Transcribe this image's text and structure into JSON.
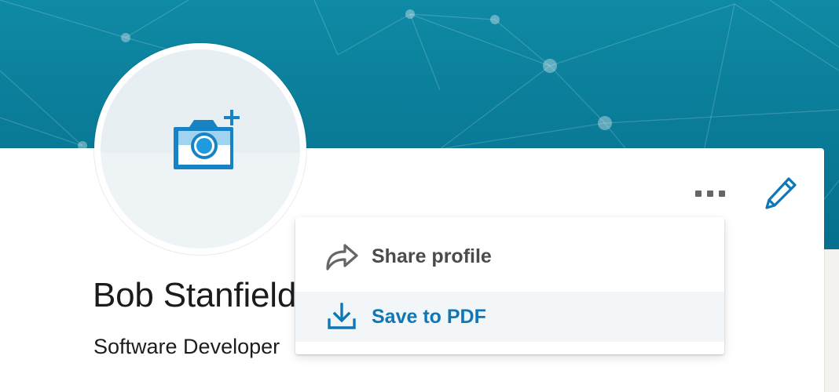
{
  "profile": {
    "name": "Bob Stanfield",
    "headline": "Software Developer"
  },
  "menu": {
    "items": [
      {
        "label": "Share profile",
        "icon": "share-arrow-icon"
      },
      {
        "label": "Save to PDF",
        "icon": "download-icon"
      }
    ]
  },
  "actions": {
    "more_icon": "more-horizontal-icon",
    "edit_icon": "pencil-icon",
    "photo_icon": "camera-add-icon"
  },
  "colors": {
    "banner": "#0a7d99",
    "accent": "#0e77b7",
    "camera_blue": "#1883c4",
    "camera_light": "#9fd3f0",
    "text_dark": "#1b1b1b",
    "menu_text": "#4b4b4b",
    "highlight_row": "#f3f6f8"
  }
}
